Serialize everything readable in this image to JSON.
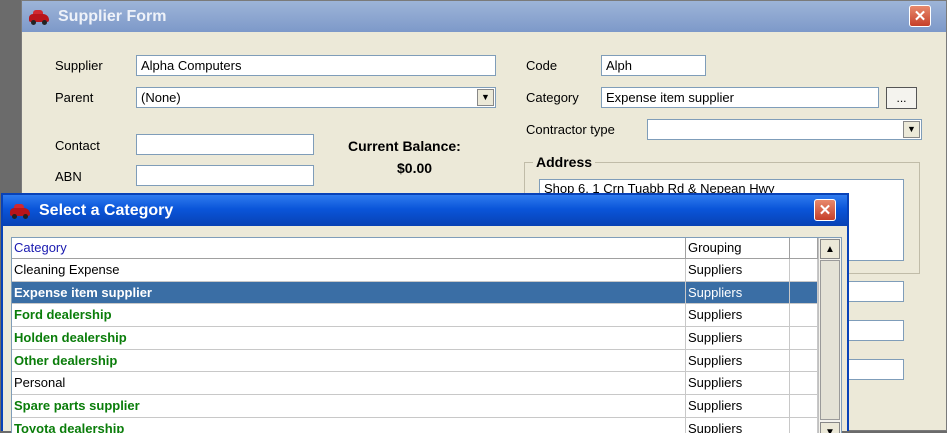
{
  "supplier_form": {
    "title": "Supplier Form",
    "close_glyph": "✕",
    "supplier_label": "Supplier",
    "supplier_value": "Alpha Computers",
    "parent_label": "Parent",
    "parent_value": "(None)",
    "contact_label": "Contact",
    "contact_value": "",
    "abn_label": "ABN",
    "abn_value": "",
    "balance_label": "Current Balance:",
    "balance_value": "$0.00",
    "code_label": "Code",
    "code_value": "Alph",
    "category_label": "Category",
    "category_value": "Expense item supplier",
    "browse_label": "...",
    "contractor_label": "Contractor type",
    "contractor_value": "",
    "address_legend": "Address",
    "address_value": "Shop 6, 1 Crn Tuabb Rd & Nepean Hwy"
  },
  "category_dialog": {
    "title": "Select a Category",
    "close_glyph": "✕",
    "columns": [
      "Category",
      "Grouping",
      ""
    ],
    "rows": [
      {
        "category": "Cleaning Expense",
        "grouping": "Suppliers",
        "style": "normal"
      },
      {
        "category": "Expense item supplier",
        "grouping": "Suppliers",
        "style": "selected"
      },
      {
        "category": "Ford dealership",
        "grouping": "Suppliers",
        "style": "green"
      },
      {
        "category": "Holden dealership",
        "grouping": "Suppliers",
        "style": "green"
      },
      {
        "category": "Other dealership",
        "grouping": "Suppliers",
        "style": "green"
      },
      {
        "category": "Personal",
        "grouping": "Suppliers",
        "style": "normal"
      },
      {
        "category": "Spare parts supplier",
        "grouping": "Suppliers",
        "style": "green"
      },
      {
        "category": "Toyota dealership",
        "grouping": "Suppliers",
        "style": "green"
      }
    ]
  },
  "colors": {
    "selected_row": "#3a6ea5",
    "green_text": "#0a7d0a",
    "title_active": "#0a55d9"
  },
  "icons": {
    "app": "red-car-icon",
    "close": "close-icon",
    "combo": "chevron-down-icon",
    "scroll_up": "arrow-up-icon",
    "scroll_down": "arrow-down-icon"
  }
}
